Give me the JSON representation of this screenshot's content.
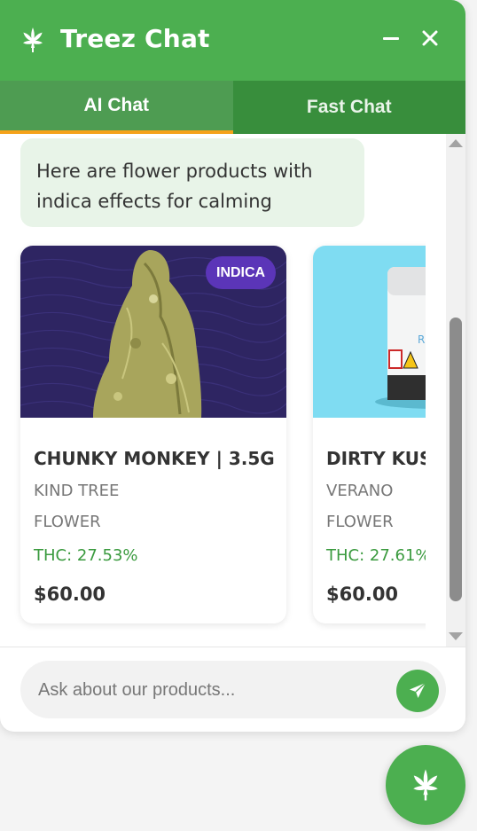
{
  "header": {
    "title": "Treez Chat",
    "logo_icon": "cannabis-leaf-icon",
    "minimize_icon": "minimize-icon",
    "close_icon": "close-icon"
  },
  "tabs": [
    {
      "label": "AI Chat",
      "active": true
    },
    {
      "label": "Fast Chat",
      "active": false
    }
  ],
  "messages": [
    {
      "from": "bot",
      "text": "Here are flower products with indica effects for calming"
    }
  ],
  "products": [
    {
      "badge": "INDICA",
      "name": "CHUNKY MONKEY | 3.5G",
      "brand": "KIND TREE",
      "type": "FLOWER",
      "thc": "THC: 27.53%",
      "price": "$60.00"
    },
    {
      "badge": "",
      "name": "DIRTY KUSH",
      "brand": "VERANO",
      "type": "FLOWER",
      "thc": "THC: 27.61%",
      "price": "$60.00"
    }
  ],
  "composer": {
    "placeholder": "Ask about our products...",
    "send_icon": "send-icon"
  },
  "fab_icon": "cannabis-leaf-icon",
  "colors": {
    "brand_green": "#4caf50",
    "tab_active_underline": "#f5a21a",
    "badge_indica": "#5b35b8",
    "thc_green": "#3a9a3e"
  }
}
